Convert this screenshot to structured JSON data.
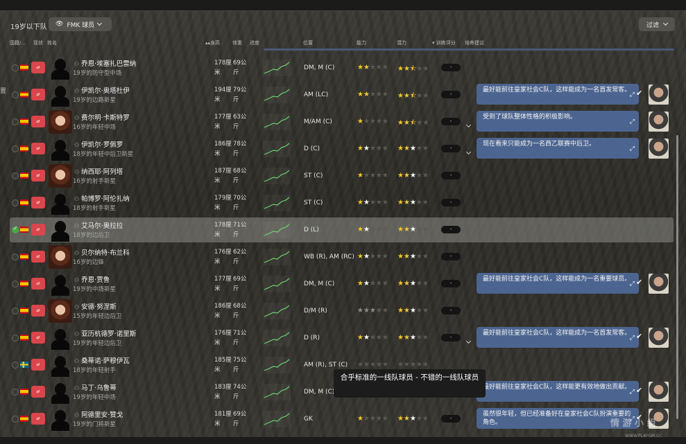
{
  "header": {
    "squad_label": "19岁以下队",
    "view_label": "FMK 球员",
    "filter_label": "过滤"
  },
  "columns": {
    "nation": "国籍/...",
    "status": "现状",
    "name": "姓名",
    "height": "身高",
    "weight": "体重",
    "trend": "进度",
    "position": "位置",
    "ability": "能力",
    "potential": "潜力",
    "training": "训练评分",
    "advice": "培养建议"
  },
  "side_fragment": "置",
  "rows": [
    {
      "name": "乔恩·埃塞扎巴雷纳",
      "role": "19岁的防守型中场",
      "height": "178厘米",
      "weight": "69公斤",
      "position": "DM, M (C)",
      "ability": [
        1,
        1,
        0,
        0,
        0
      ],
      "potential": [
        1,
        1,
        2,
        0,
        0
      ],
      "pill": "-",
      "photo": false,
      "flag": "esp",
      "advice": null
    },
    {
      "name": "伊凯尔·奥塔杜伊",
      "role": "19岁的边路新星",
      "height": "194厘米",
      "weight": "79公斤",
      "position": "AM (LC)",
      "ability": [
        1,
        1,
        0,
        0,
        0
      ],
      "potential": [
        1,
        1,
        2,
        0,
        0
      ],
      "pill": "-",
      "photo": false,
      "flag": "esp",
      "advice": "最好能前往皇家社会C队，这样能成为一名首发常客。"
    },
    {
      "name": "费尔明·卡斯特罗",
      "role": "16岁的年轻中场",
      "height": "177厘米",
      "weight": "63公斤",
      "position": "M/AM (C)",
      "ability": [
        1,
        0,
        0,
        0,
        0
      ],
      "potential": [
        1,
        1,
        2,
        0,
        0
      ],
      "pill": "-",
      "photo": true,
      "flag": "esp",
      "advice": "受到了球队整体性格的积极影响。"
    },
    {
      "name": "伊凯尔·罗佩罗",
      "role": "18岁的年轻中后卫新星",
      "height": "186厘米",
      "weight": "78公斤",
      "position": "D (C)",
      "ability": [
        1,
        3,
        0,
        0,
        0
      ],
      "potential": [
        1,
        1,
        3,
        0,
        0
      ],
      "pill": "-",
      "photo": false,
      "flag": "esp",
      "advice": "现在看来只能成为一名西乙联赛中后卫。"
    },
    {
      "name": "纳西耶·阿列塔",
      "role": "16岁的射手新星",
      "height": "187厘米",
      "weight": "68公斤",
      "position": "ST (C)",
      "ability": [
        1,
        0,
        0,
        0,
        0
      ],
      "potential": [
        1,
        1,
        3,
        0,
        0
      ],
      "pill": "-",
      "photo": true,
      "flag": "esp",
      "advice": null
    },
    {
      "name": "帕博罗·阿伦扎纳",
      "role": "18岁的射手新星",
      "height": "179厘米",
      "weight": "70公斤",
      "position": "ST (C)",
      "ability": [
        1,
        3,
        0,
        0,
        0
      ],
      "potential": [
        1,
        1,
        3,
        0,
        0
      ],
      "pill": "-",
      "photo": false,
      "flag": "esp",
      "advice": null
    },
    {
      "name": "艾马尔·奥拉拉",
      "role": "18岁的边后卫",
      "height": "178厘米",
      "weight": "71公斤",
      "position": "D (L)",
      "ability": [
        1,
        3,
        0,
        0,
        0
      ],
      "potential": [
        1,
        1,
        3,
        0,
        0
      ],
      "pill": "-",
      "photo": false,
      "flag": "esp",
      "advice": null,
      "selected": true
    },
    {
      "name": "贝尔纳特·布兰科",
      "role": "16岁的边锋",
      "height": "176厘米",
      "weight": "62公斤",
      "position": "WB (R), AM (RC)",
      "ability": [
        1,
        3,
        0,
        0,
        0
      ],
      "potential": [
        1,
        1,
        3,
        0,
        0
      ],
      "pill": "-",
      "photo": true,
      "flag": "esp",
      "advice": null
    },
    {
      "name": "乔恩·贾鲁",
      "role": "19岁的中场新星",
      "height": "177厘米",
      "weight": "69公斤",
      "position": "DM, M (C)",
      "ability": [
        1,
        3,
        0,
        0,
        0
      ],
      "potential": [
        1,
        1,
        3,
        0,
        0
      ],
      "pill": "-",
      "photo": false,
      "flag": "esp",
      "advice": "最好能前往皇家社会C队，这样能成为一名重要球员。"
    },
    {
      "name": "安德·努涅斯",
      "role": "15岁的年轻边后卫",
      "height": "186厘米",
      "weight": "68公斤",
      "position": "D/M (R)",
      "ability": [
        4,
        4,
        4,
        0,
        0
      ],
      "potential": [
        1,
        1,
        3,
        0,
        0
      ],
      "pill": "-",
      "photo": true,
      "flag": "esp",
      "advice": null
    },
    {
      "name": "亚历杭德罗·诺里斯",
      "role": "19岁的年轻边后卫",
      "height": "176厘米",
      "weight": "71公斤",
      "position": "D (R)",
      "ability": [
        1,
        3,
        0,
        0,
        0
      ],
      "potential": [
        1,
        1,
        3,
        0,
        0
      ],
      "pill": "-",
      "photo": false,
      "flag": "esp",
      "advice": "最好能前往皇家社会C队，这样能成为一名首发常客。"
    },
    {
      "name": "桑蒂诺·萨穆伊瓦",
      "role": "18岁的年轻射手",
      "height": "185厘米",
      "weight": "75公斤",
      "position": "AM (R), ST (C)",
      "ability": [
        0,
        0,
        0,
        0,
        0
      ],
      "potential": [
        0,
        0,
        0,
        0,
        0
      ],
      "pill": "",
      "photo": false,
      "flag": "swe",
      "advice": null
    },
    {
      "name": "马丁·乌鲁蒂",
      "role": "19岁的年轻中场",
      "height": "183厘米",
      "weight": "74公斤",
      "position": "DM, M (C)",
      "ability": [
        0,
        0,
        0,
        0,
        0
      ],
      "potential": [
        1,
        1,
        3,
        0,
        0
      ],
      "pill": "-",
      "photo": false,
      "flag": "esp",
      "advice": "最好能前往皇家社会C队，这样能更有效地做出贡献。"
    },
    {
      "name": "阿德里安·赞戈",
      "role": "19岁的门将新星",
      "height": "181厘米",
      "weight": "69公斤",
      "position": "GK",
      "ability": [
        1,
        0,
        0,
        0,
        0
      ],
      "potential": [
        1,
        1,
        3,
        0,
        0
      ],
      "pill": "-",
      "photo": false,
      "flag": "esp",
      "advice": "虽然很年轻，但已经准备好在皇家社会C队扮演重要的角色。"
    }
  ],
  "tooltip": "合乎标准的一线队球员 - 不错的一线队球员",
  "watermark": {
    "cn": "情 游 小 组",
    "url": "WWW.PLAYGM.CC"
  }
}
